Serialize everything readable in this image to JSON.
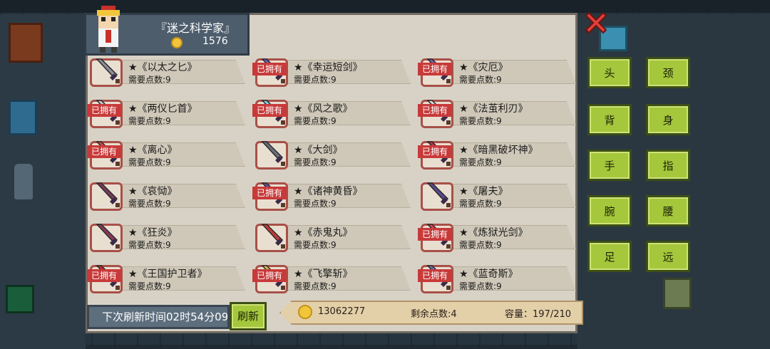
{
  "header": {
    "title": "『迷之科学家』",
    "coins": "1576"
  },
  "weapons": [
    {
      "name": "★《以太之匕》",
      "cost": "需要点数:9",
      "owned": false,
      "color": "#8a8f98"
    },
    {
      "name": "★《幸运短剑》",
      "cost": "需要点数:9",
      "owned": true,
      "color": "#6b5bb5"
    },
    {
      "name": "★《灾厄》",
      "cost": "需要点数:9",
      "owned": true,
      "color": "#7a5aa8"
    },
    {
      "name": "★《两仪匕首》",
      "cost": "需要点数:9",
      "owned": true,
      "color": "#c8c8c8"
    },
    {
      "name": "★《风之歌》",
      "cost": "需要点数:9",
      "owned": true,
      "color": "#7fd4e8"
    },
    {
      "name": "★《法茧利刃》",
      "cost": "需要点数:9",
      "owned": true,
      "color": "#d9d9d9"
    },
    {
      "name": "★《离心》",
      "cost": "需要点数:9",
      "owned": true,
      "color": "#d04a3a"
    },
    {
      "name": "★《大剑》",
      "cost": "需要点数:9",
      "owned": false,
      "color": "#6a6f7a"
    },
    {
      "name": "★《暗黑破坏神》",
      "cost": "需要点数:9",
      "owned": true,
      "color": "#c03040"
    },
    {
      "name": "★《哀恸》",
      "cost": "需要点数:9",
      "owned": false,
      "color": "#7a3a5a"
    },
    {
      "name": "★《诸神黄昏》",
      "cost": "需要点数:9",
      "owned": true,
      "color": "#6b4a9a"
    },
    {
      "name": "★《屠夫》",
      "cost": "需要点数:9",
      "owned": false,
      "color": "#5a4a8a"
    },
    {
      "name": "★《狂炎》",
      "cost": "需要点数:9",
      "owned": false,
      "color": "#8a3a5a"
    },
    {
      "name": "★《赤鬼丸》",
      "cost": "需要点数:9",
      "owned": false,
      "color": "#c03a3a"
    },
    {
      "name": "★《炼狱光剑》",
      "cost": "需要点数:9",
      "owned": true,
      "color": "#e0404a"
    },
    {
      "name": "★《王国护卫者》",
      "cost": "需要点数:9",
      "owned": true,
      "color": "#c02a2a"
    },
    {
      "name": "★《飞擎斩》",
      "cost": "需要点数:9",
      "owned": true,
      "color": "#d8b84a"
    },
    {
      "name": "★《蓝奇斯》",
      "cost": "需要点数:9",
      "owned": true,
      "color": "#6a6ab0"
    }
  ],
  "owned_label": "已拥有",
  "categories": [
    "头",
    "颈",
    "背",
    "身",
    "手",
    "指",
    "腕",
    "腰",
    "足",
    "远"
  ],
  "footer": {
    "refresh_timer": "下次刷新时间02时54分09",
    "refresh_label": "刷新",
    "gold_total": "13062277",
    "points_left": "剩余点数:4",
    "capacity": "容量：197/210"
  },
  "colors": {
    "button_green": "#a5c73c",
    "owned_red": "#c83a3a",
    "panel": "#d8d2c6"
  }
}
